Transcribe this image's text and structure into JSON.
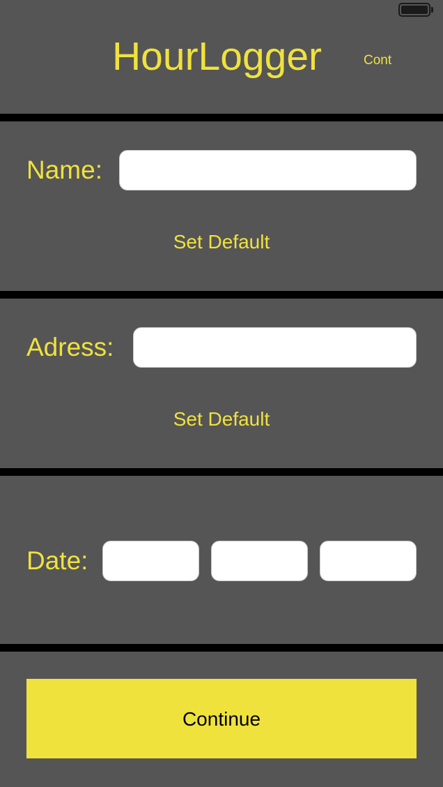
{
  "app": {
    "title": "HourLogger",
    "cont_label": "Cont"
  },
  "status_bar": {
    "battery_icon": "battery-icon"
  },
  "name_section": {
    "label": "Name:",
    "value": "",
    "placeholder": "",
    "set_default_label": "Set Default"
  },
  "address_section": {
    "label": "Adress:",
    "value": "",
    "placeholder": "",
    "set_default_label": "Set Default"
  },
  "date_section": {
    "label": "Date:",
    "fields": [
      {
        "value": "",
        "placeholder": ""
      },
      {
        "value": "",
        "placeholder": ""
      },
      {
        "value": "",
        "placeholder": ""
      }
    ]
  },
  "footer": {
    "continue_label": "Continue"
  },
  "colors": {
    "background": "#555555",
    "separator": "#000000",
    "accent": "#F0E23D",
    "field_background": "#FFFFFF"
  }
}
